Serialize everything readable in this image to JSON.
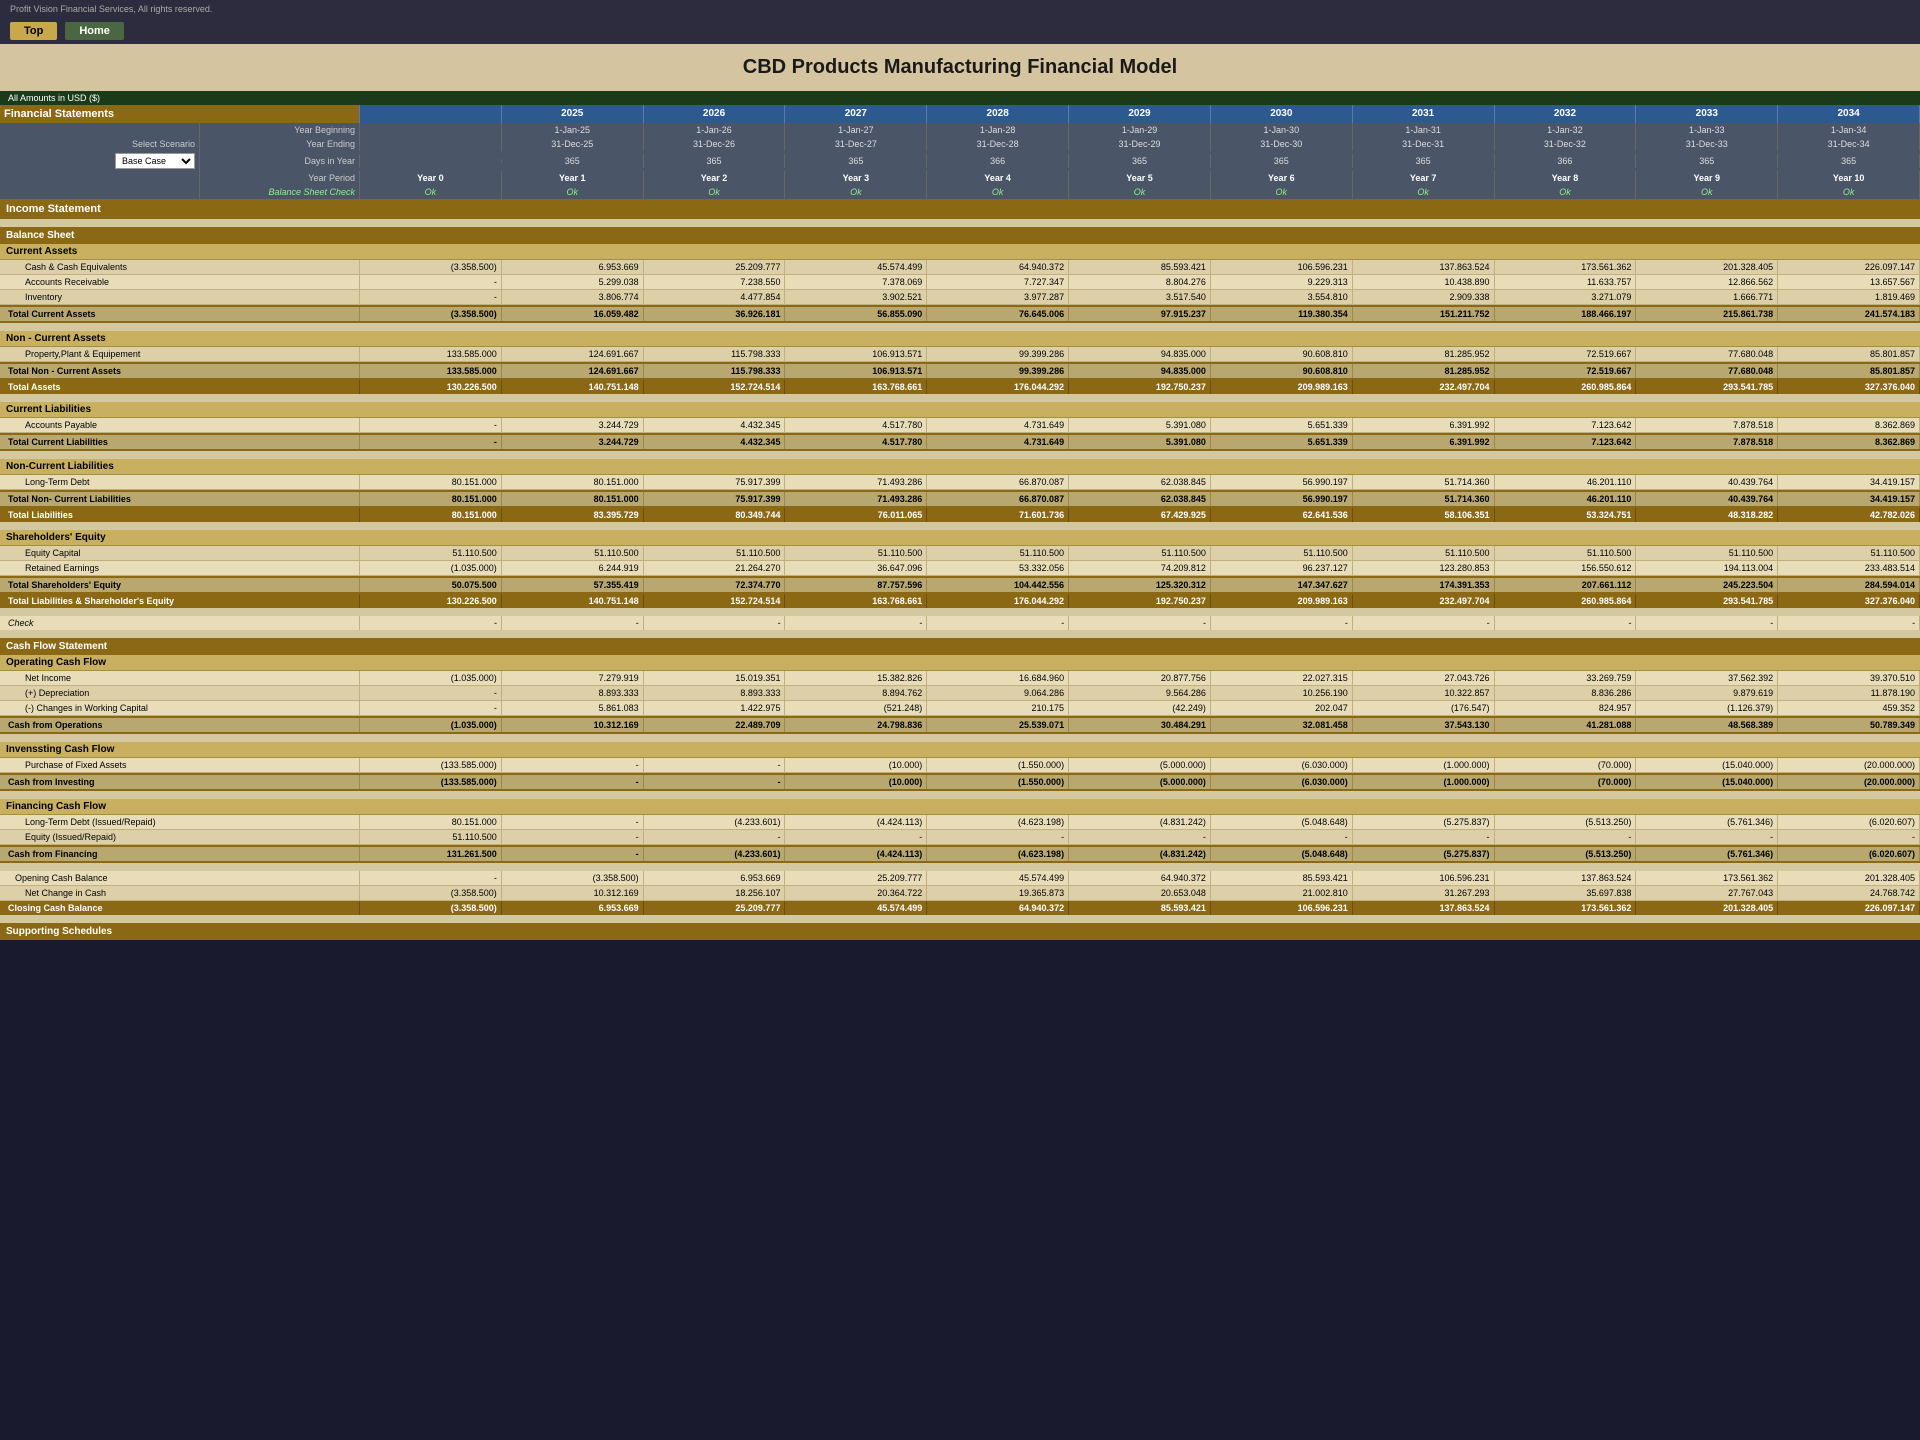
{
  "header": {
    "brand": "Profit Vision Financial Services, All rights reserved.",
    "top_button": "Top",
    "home_button": "Home",
    "title": "CBD Products Manufacturing Financial Model",
    "currency_note": "All Amounts in  USD ($)"
  },
  "years": {
    "labels": [
      "2025",
      "2026",
      "2027",
      "2028",
      "2029",
      "2030",
      "2031",
      "2032",
      "2033",
      "2034"
    ],
    "year_beginning": [
      "1-Jan-25",
      "1-Jan-26",
      "1-Jan-27",
      "1-Jan-28",
      "1-Jan-29",
      "1-Jan-30",
      "1-Jan-31",
      "1-Jan-32",
      "1-Jan-33",
      "1-Jan-34"
    ],
    "year_ending": [
      "31-Dec-25",
      "31-Dec-26",
      "31-Dec-27",
      "31-Dec-28",
      "31-Dec-29",
      "31-Dec-30",
      "31-Dec-31",
      "31-Dec-32",
      "31-Dec-33",
      "31-Dec-34"
    ],
    "days": [
      "365",
      "365",
      "365",
      "366",
      "365",
      "365",
      "365",
      "366",
      "365",
      "365"
    ],
    "periods": [
      "Year 0",
      "Year 1",
      "Year 2",
      "Year 3",
      "Year 4",
      "Year 5",
      "Year 6",
      "Year 7",
      "Year 8",
      "Year 9",
      "Year 10"
    ],
    "balance_check": [
      "Ok",
      "Ok",
      "Ok",
      "Ok",
      "Ok",
      "Ok",
      "Ok",
      "Ok",
      "Ok",
      "Ok",
      "Ok"
    ]
  },
  "sections": {
    "financial_statements": "Financial Statements",
    "income_statement": "Income Statement",
    "balance_sheet": "Balance Sheet",
    "cash_flow": "Cash Flow Statement"
  },
  "balance_sheet": {
    "current_assets_title": "Current Assets",
    "cash": {
      "label": "Cash & Cash Equivalents",
      "values": [
        "(3.358.500)",
        "6.953.669",
        "25.209.777",
        "45.574.499",
        "64.940.372",
        "85.593.421",
        "106.596.231",
        "137.863.524",
        "173.561.362",
        "201.328.405",
        "226.097.147"
      ]
    },
    "ar": {
      "label": "Accounts Receivable",
      "values": [
        "-",
        "5.299.038",
        "7.238.550",
        "7.378.069",
        "7.727.347",
        "8.804.276",
        "9.229.313",
        "10.438.890",
        "11.633.757",
        "12.866.562",
        "13.657.567"
      ]
    },
    "inventory": {
      "label": "Inventory",
      "values": [
        "-",
        "3.806.774",
        "4.477.854",
        "3.902.521",
        "3.977.287",
        "3.517.540",
        "3.554.810",
        "2.909.338",
        "3.271.079",
        "1.666.771",
        "1.819.469"
      ]
    },
    "total_current_assets": {
      "label": "Total Current Assets",
      "values": [
        "(3.358.500)",
        "16.059.482",
        "36.926.181",
        "56.855.090",
        "76.645.006",
        "97.915.237",
        "119.380.354",
        "151.211.752",
        "188.466.197",
        "215.861.738",
        "241.574.183"
      ]
    },
    "non_current_title": "Non - Current Assets",
    "ppe": {
      "label": "Property,Plant & Equipement",
      "values": [
        "133.585.000",
        "124.691.667",
        "115.798.333",
        "106.913.571",
        "99.399.286",
        "94.835.000",
        "90.608.810",
        "81.285.952",
        "72.519.667",
        "77.680.048",
        "85.801.857"
      ]
    },
    "total_non_current": {
      "label": "Total Non - Current Assets",
      "values": [
        "133.585.000",
        "124.691.667",
        "115.798.333",
        "106.913.571",
        "99.399.286",
        "94.835.000",
        "90.608.810",
        "81.285.952",
        "72.519.667",
        "77.680.048",
        "85.801.857"
      ]
    },
    "total_assets": {
      "label": "Total Assets",
      "values": [
        "130.226.500",
        "140.751.148",
        "152.724.514",
        "163.768.661",
        "176.044.292",
        "192.750.237",
        "209.989.163",
        "232.497.704",
        "260.985.864",
        "293.541.785",
        "327.376.040"
      ]
    },
    "current_liabilities_title": "Current Liabilities",
    "ap": {
      "label": "Accounts Payable",
      "values": [
        "-",
        "3.244.729",
        "4.432.345",
        "4.517.780",
        "4.731.649",
        "5.391.080",
        "5.651.339",
        "6.391.992",
        "7.123.642",
        "7.878.518",
        "8.362.869"
      ]
    },
    "total_current_liabilities": {
      "label": "Total Current Liabilities",
      "values": [
        "-",
        "3.244.729",
        "4.432.345",
        "4.517.780",
        "4.731.649",
        "5.391.080",
        "5.651.339",
        "6.391.992",
        "7.123.642",
        "7.878.518",
        "8.362.869"
      ]
    },
    "non_current_liabilities_title": "Non-Current Liabilities",
    "ltd": {
      "label": "Long-Term Debt",
      "values": [
        "80.151.000",
        "80.151.000",
        "75.917.399",
        "71.493.286",
        "66.870.087",
        "62.038.845",
        "56.990.197",
        "51.714.360",
        "46.201.110",
        "40.439.764",
        "34.419.157"
      ]
    },
    "total_non_current_liabilities": {
      "label": "Total Non- Current Liabilities",
      "values": [
        "80.151.000",
        "80.151.000",
        "75.917.399",
        "71.493.286",
        "66.870.087",
        "62.038.845",
        "56.990.197",
        "51.714.360",
        "46.201.110",
        "40.439.764",
        "34.419.157"
      ]
    },
    "total_liabilities": {
      "label": "Total Liabilities",
      "values": [
        "80.151.000",
        "83.395.729",
        "80.349.744",
        "76.011.065",
        "71.601.736",
        "67.429.925",
        "62.641.536",
        "58.106.351",
        "53.324.751",
        "48.318.282",
        "42.782.026"
      ]
    },
    "equity_title": "Shareholders' Equity",
    "equity_capital": {
      "label": "Equity Capital",
      "values": [
        "51.110.500",
        "51.110.500",
        "51.110.500",
        "51.110.500",
        "51.110.500",
        "51.110.500",
        "51.110.500",
        "51.110.500",
        "51.110.500",
        "51.110.500",
        "51.110.500"
      ]
    },
    "retained_earnings": {
      "label": "Retained Earnings",
      "values": [
        "(1.035.000)",
        "6.244.919",
        "21.264.270",
        "36.647.096",
        "53.332.056",
        "74.209.812",
        "96.237.127",
        "123.280.853",
        "156.550.612",
        "194.113.004",
        "233.483.514"
      ]
    },
    "total_equity": {
      "label": "Total Shareholders' Equity",
      "values": [
        "50.075.500",
        "57.355.419",
        "72.374.770",
        "87.757.596",
        "104.442.556",
        "125.320.312",
        "147.347.627",
        "174.391.353",
        "207.661.112",
        "245.223.504",
        "284.594.014"
      ]
    },
    "total_liabilities_equity": {
      "label": "Total Liabilities & Shareholder's Equity",
      "values": [
        "130.226.500",
        "140.751.148",
        "152.724.514",
        "163.768.661",
        "176.044.292",
        "192.750.237",
        "209.989.163",
        "232.497.704",
        "260.985.864",
        "293.541.785",
        "327.376.040"
      ]
    },
    "check_label": "Check",
    "check_values": [
      "-",
      "-",
      "-",
      "-",
      "-",
      "-",
      "-",
      "-",
      "-",
      "-",
      "-"
    ]
  },
  "cash_flow": {
    "operating_title": "Operating Cash Flow",
    "net_income": {
      "label": "Net Income",
      "values": [
        "(1.035.000)",
        "7.279.919",
        "15.019.351",
        "15.382.826",
        "16.684.960",
        "20.877.756",
        "22.027.315",
        "27.043.726",
        "33.269.759",
        "37.562.392",
        "39.370.510"
      ]
    },
    "depreciation": {
      "label": "(+) Depreciation",
      "values": [
        "-",
        "8.893.333",
        "8.893.333",
        "8.894.762",
        "9.064.286",
        "9.564.286",
        "10.256.190",
        "10.322.857",
        "8.836.286",
        "9.879.619",
        "11.878.190"
      ]
    },
    "changes_wc": {
      "label": "(-) Changes in Working Capital",
      "values": [
        "-",
        "5.861.083",
        "1.422.975",
        "(521.248)",
        "210.175",
        "(42.249)",
        "202.047",
        "(176.547)",
        "824.957",
        "(1.126.379)",
        "459.352"
      ]
    },
    "cash_from_operations": {
      "label": "Cash from Operations",
      "values": [
        "(1.035.000)",
        "10.312.169",
        "22.489.709",
        "24.798.836",
        "25.539.071",
        "30.484.291",
        "32.081.458",
        "37.543.130",
        "41.281.088",
        "48.568.389",
        "50.789.349"
      ]
    },
    "investing_title": "Invenssting Cash Flow",
    "purchase_fixed": {
      "label": "Purchase of Fixed Assets",
      "values": [
        "(133.585.000)",
        "-",
        "-",
        "(10.000)",
        "(1.550.000)",
        "(5.000.000)",
        "(6.030.000)",
        "(1.000.000)",
        "(70.000)",
        "(15.040.000)",
        "(20.000.000)"
      ]
    },
    "cash_from_investing": {
      "label": "Cash from Investing",
      "values": [
        "(133.585.000)",
        "-",
        "-",
        "(10.000)",
        "(1.550.000)",
        "(5.000.000)",
        "(6.030.000)",
        "(1.000.000)",
        "(70.000)",
        "(15.040.000)",
        "(20.000.000)"
      ]
    },
    "financing_title": "Financing Cash Flow",
    "ltd_issued": {
      "label": "Long-Term Debt (Issued/Repaid)",
      "values": [
        "80.151.000",
        "-",
        "(4.233.601)",
        "(4.424.113)",
        "(4.623.198)",
        "(4.831.242)",
        "(5.048.648)",
        "(5.275.837)",
        "(5.513.250)",
        "(5.761.346)",
        "(6.020.607)"
      ]
    },
    "equity_issued": {
      "label": "Equity (Issued/Repaid)",
      "values": [
        "51.110.500",
        "-",
        "-",
        "-",
        "-",
        "-",
        "-",
        "-",
        "-",
        "-",
        "-"
      ]
    },
    "cash_from_financing": {
      "label": "Cash from Financing",
      "values": [
        "131.261.500",
        "-",
        "(4.233.601)",
        "(4.424.113)",
        "(4.623.198)",
        "(4.831.242)",
        "(5.048.648)",
        "(5.275.837)",
        "(5.513.250)",
        "(5.761.346)",
        "(6.020.607)"
      ]
    },
    "opening_cash": {
      "label": "Opening Cash Balance",
      "values": [
        "-",
        "(3.358.500)",
        "6.953.669",
        "25.209.777",
        "45.574.499",
        "64.940.372",
        "85.593.421",
        "106.596.231",
        "137.863.524",
        "173.561.362",
        "201.328.405"
      ]
    },
    "net_change": {
      "label": "Net Change in Cash",
      "values": [
        "(3.358.500)",
        "10.312.169",
        "18.256.107",
        "20.364.722",
        "19.365.873",
        "20.653.048",
        "21.002.810",
        "31.267.293",
        "35.697.838",
        "27.767.043",
        "24.768.742"
      ]
    },
    "closing_cash": {
      "label": "Closing Cash Balance",
      "values": [
        "(3.358.500)",
        "6.953.669",
        "25.209.777",
        "45.574.499",
        "64.940.372",
        "85.593.421",
        "106.596.231",
        "137.863.524",
        "173.561.362",
        "201.328.405",
        "226.097.147"
      ]
    },
    "supporting_schedules": "Supporting Schedules"
  },
  "scenario": {
    "label": "Select Scenario",
    "value": "Base Case"
  }
}
